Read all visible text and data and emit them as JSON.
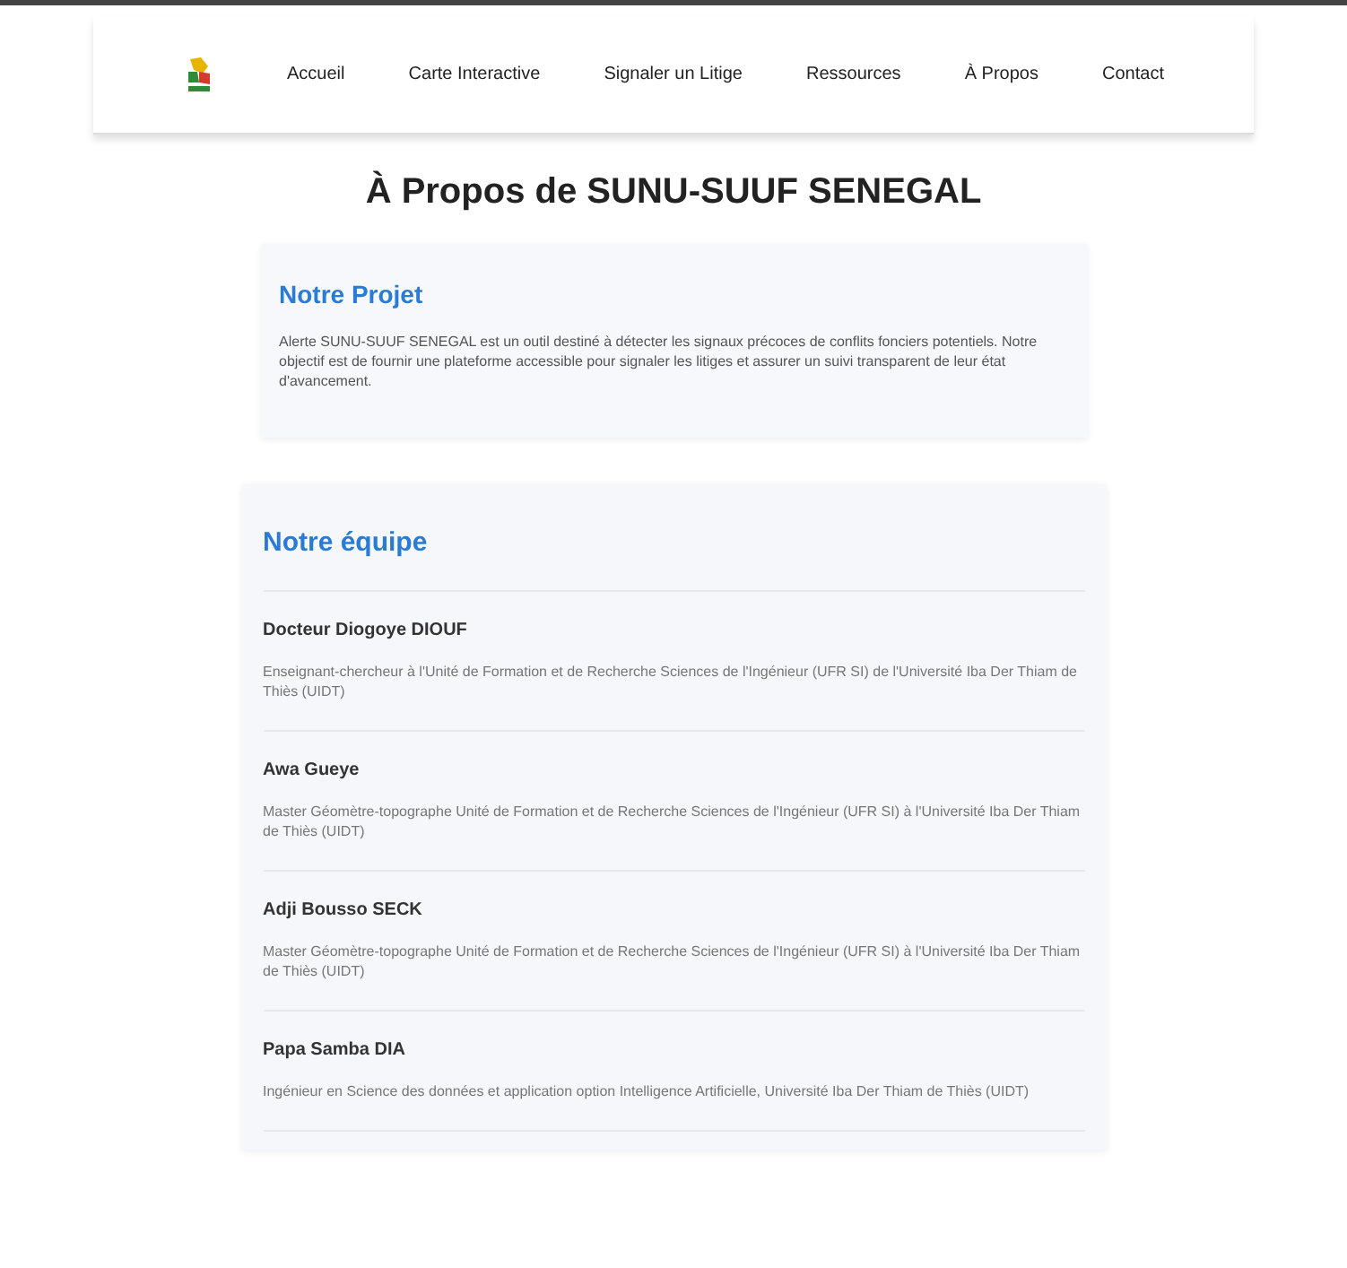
{
  "nav": {
    "items": [
      {
        "label": "Accueil"
      },
      {
        "label": "Carte Interactive"
      },
      {
        "label": "Signaler un Litige"
      },
      {
        "label": "Ressources"
      },
      {
        "label": "À Propos"
      },
      {
        "label": "Contact"
      }
    ]
  },
  "title": "À Propos de SUNU-SUUF SENEGAL",
  "project": {
    "heading": "Notre Projet",
    "text": "Alerte SUNU-SUUF SENEGAL est un outil destiné à détecter les signaux précoces de conflits fonciers potentiels. Notre objectif est de fournir une plateforme accessible pour signaler les litiges et assurer un suivi transparent de leur état d'avancement."
  },
  "team": {
    "heading": "Notre équipe",
    "members": [
      {
        "name": "Docteur Diogoye DIOUF",
        "role": "Enseignant-chercheur à l'Unité de Formation et de Recherche Sciences de l'Ingénieur (UFR SI) de l'Université Iba Der Thiam de Thiès (UIDT)"
      },
      {
        "name": "Awa Gueye",
        "role": "Master Géomètre-topographe Unité de Formation et de Recherche Sciences de l'Ingénieur (UFR SI) à l'Université Iba Der Thiam de Thiès (UIDT)"
      },
      {
        "name": "Adji Bousso SECK",
        "role": "Master Géomètre-topographe Unité de Formation et de Recherche Sciences de l'Ingénieur (UFR SI) à l'Université Iba Der Thiam de Thiès (UIDT)"
      },
      {
        "name": "Papa Samba DIA",
        "role": "Ingénieur en Science des données et application option Intelligence Artificielle, Université Iba Der Thiam de Thiès (UIDT)"
      }
    ]
  }
}
